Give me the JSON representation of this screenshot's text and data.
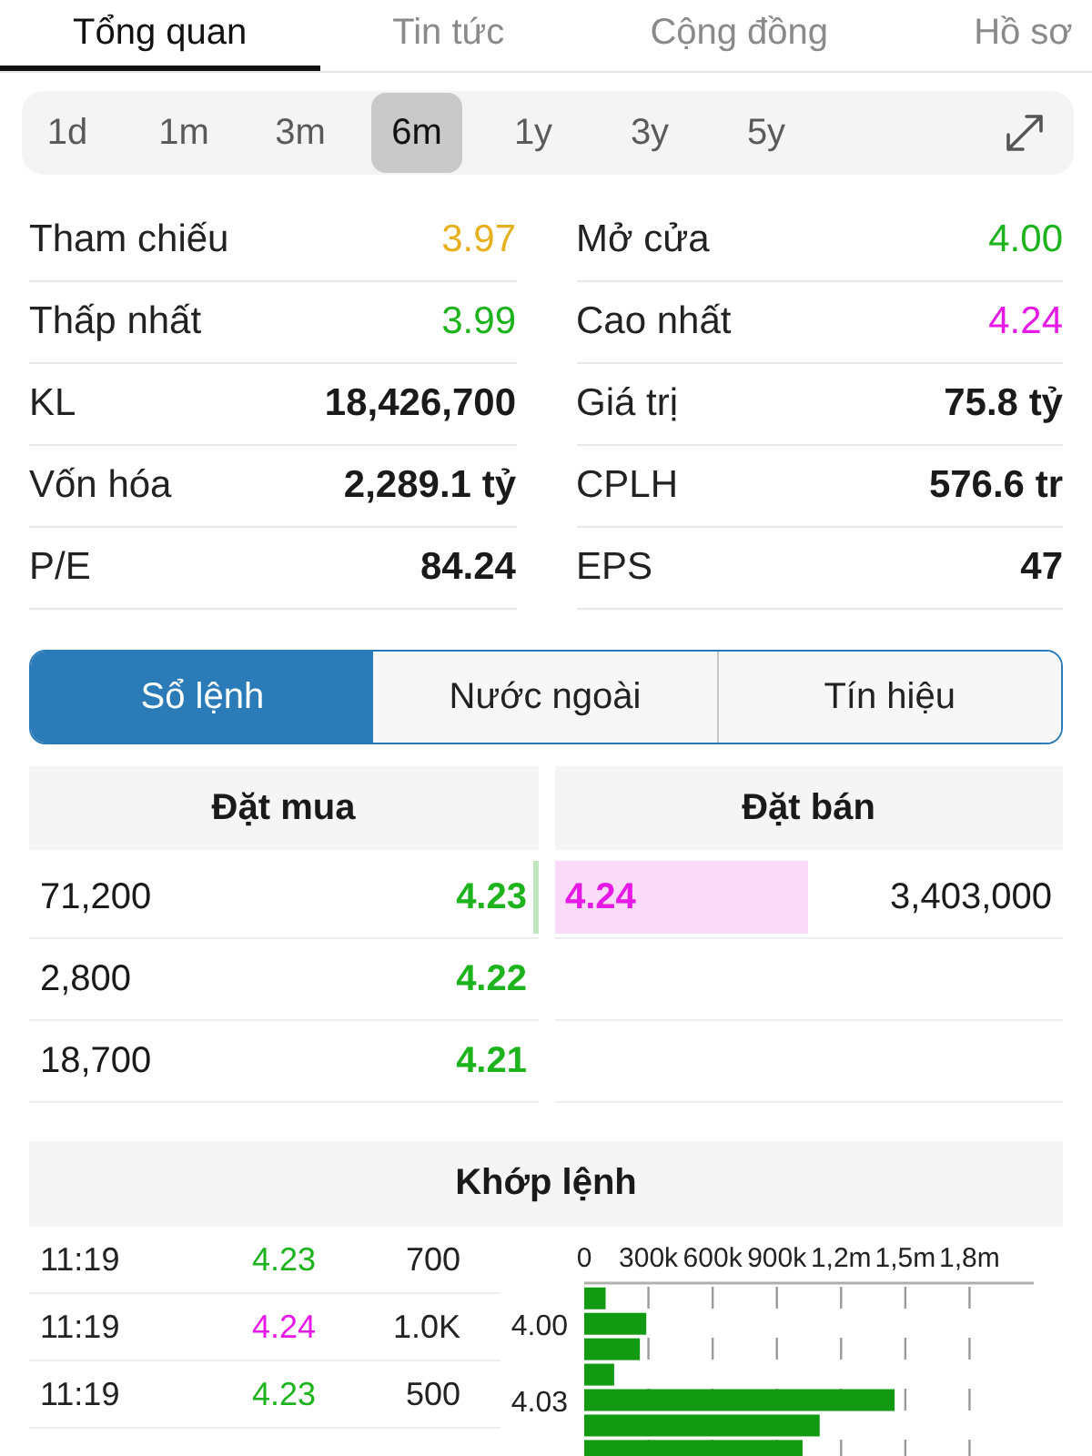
{
  "top_tabs": [
    {
      "label": "Tổng quan",
      "selected": true
    },
    {
      "label": "Tin tức",
      "selected": false
    },
    {
      "label": "Cộng đồng",
      "selected": false
    },
    {
      "label": "Hồ sơ",
      "selected": false
    }
  ],
  "periods": [
    {
      "label": "1d",
      "selected": false
    },
    {
      "label": "1m",
      "selected": false
    },
    {
      "label": "3m",
      "selected": false
    },
    {
      "label": "6m",
      "selected": true
    },
    {
      "label": "1y",
      "selected": false
    },
    {
      "label": "3y",
      "selected": false
    },
    {
      "label": "5y",
      "selected": false
    }
  ],
  "stats": [
    {
      "label": "Tham chiếu",
      "value": "3.97",
      "color": "#e6b01e"
    },
    {
      "label": "Mở cửa",
      "value": "4.00",
      "color": "#1db31d"
    },
    {
      "label": "Thấp nhất",
      "value": "3.99",
      "color": "#1db31d"
    },
    {
      "label": "Cao nhất",
      "value": "4.24",
      "color": "#e619e6"
    },
    {
      "label": "KL",
      "value": "18,426,700"
    },
    {
      "label": "Giá trị",
      "value": "75.8 tỷ"
    },
    {
      "label": "Vốn hóa",
      "value": "2,289.1 tỷ"
    },
    {
      "label": "CPLH",
      "value": "576.6 tr"
    },
    {
      "label": "P/E",
      "value": "84.24"
    },
    {
      "label": "EPS",
      "value": "47"
    }
  ],
  "panel_tabs": [
    {
      "label": "Sổ lệnh",
      "selected": true
    },
    {
      "label": "Nước ngoài",
      "selected": false
    },
    {
      "label": "Tín hiệu",
      "selected": false
    }
  ],
  "order_book": {
    "bid_title": "Đặt mua",
    "ask_title": "Đặt bán",
    "bids": [
      {
        "volume": "71,200",
        "price": "4.23",
        "color": "#1db31d",
        "level": 0.01
      },
      {
        "volume": "2,800",
        "price": "4.22",
        "color": "#1db31d",
        "level": 0
      },
      {
        "volume": "18,700",
        "price": "4.21",
        "color": "#1db31d",
        "level": 0
      }
    ],
    "asks": [
      {
        "price": "4.24",
        "volume": "3,403,000",
        "color": "#e619e6",
        "level": 0.5
      }
    ]
  },
  "matches": {
    "title": "Khớp lệnh",
    "trades": [
      {
        "time": "11:19",
        "price": "4.23",
        "volume": "700",
        "color": "#1db31d"
      },
      {
        "time": "11:19",
        "price": "4.24",
        "volume": "1.0K",
        "color": "#e619e6"
      },
      {
        "time": "11:19",
        "price": "4.23",
        "volume": "500",
        "color": "#1db31d"
      }
    ],
    "chart_data": {
      "type": "bar",
      "orientation": "horizontal",
      "grid": true,
      "x": [
        3.99,
        4.0,
        4.01,
        4.02,
        4.03,
        4.04,
        4.05
      ],
      "values": [
        100000,
        290000,
        260000,
        140000,
        1450000,
        1100000,
        1020000
      ],
      "ylim": [
        4.052,
        3.984
      ],
      "yticks": [
        {
          "value": 4.0,
          "label": "4.00"
        },
        {
          "value": 4.03,
          "label": "4.03"
        }
      ],
      "xlim": [
        0,
        2100000
      ],
      "xticks": [
        {
          "value": 0,
          "label": "0"
        },
        {
          "value": 300000,
          "label": "300k"
        },
        {
          "value": 600000,
          "label": "600k"
        },
        {
          "value": 900000,
          "label": "900k"
        },
        {
          "value": 1200000,
          "label": "1,2m"
        },
        {
          "value": 1500000,
          "label": "1,5m"
        },
        {
          "value": 1800000,
          "label": "1,8m"
        }
      ]
    }
  }
}
